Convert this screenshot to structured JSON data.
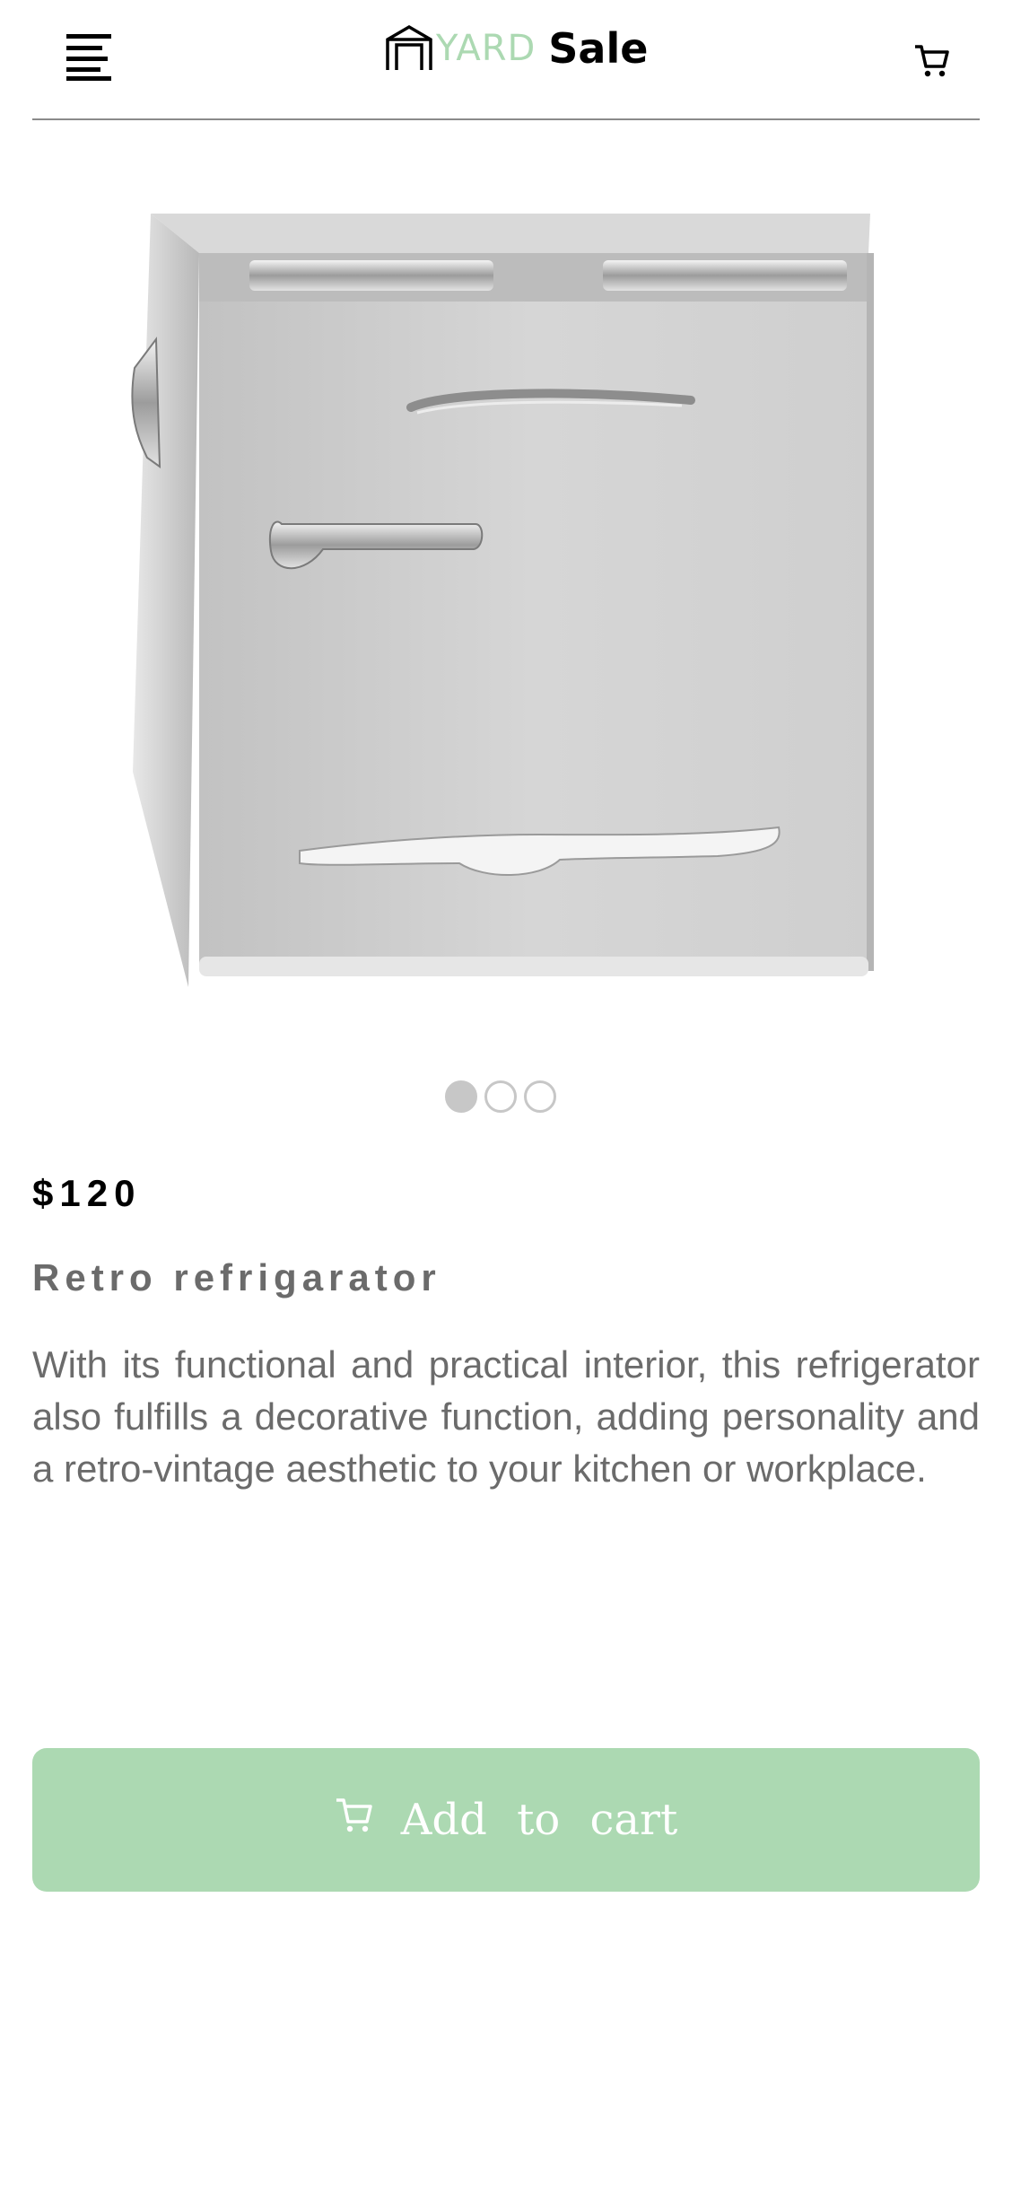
{
  "header": {
    "logo_brand_part": "YARD",
    "logo_name_part": "Sale",
    "icons": {
      "menu": "hamburger-menu-icon",
      "cart": "shopping-cart-icon",
      "logo": "garage-house-icon"
    }
  },
  "carousel": {
    "image_alt": "Retro refrigerator",
    "total_slides": 3,
    "active_slide": 1
  },
  "product": {
    "price": "$120",
    "title": "Retro refrigarator",
    "description": "With its functional and practical interior, this refrigerator also fulfills a decorative function, adding personality and a retro-vintage aesthetic to your kitchen or workplace."
  },
  "actions": {
    "add_to_cart_label": "Add to cart",
    "add_to_cart_icon": "shopping-cart-icon"
  },
  "colors": {
    "accent": "#acd9b2",
    "text_dark": "#000000",
    "text_muted": "#6b6b6b",
    "divider": "#8a8a8a",
    "dot": "#c7c7c7",
    "button_text": "#ffffff"
  }
}
